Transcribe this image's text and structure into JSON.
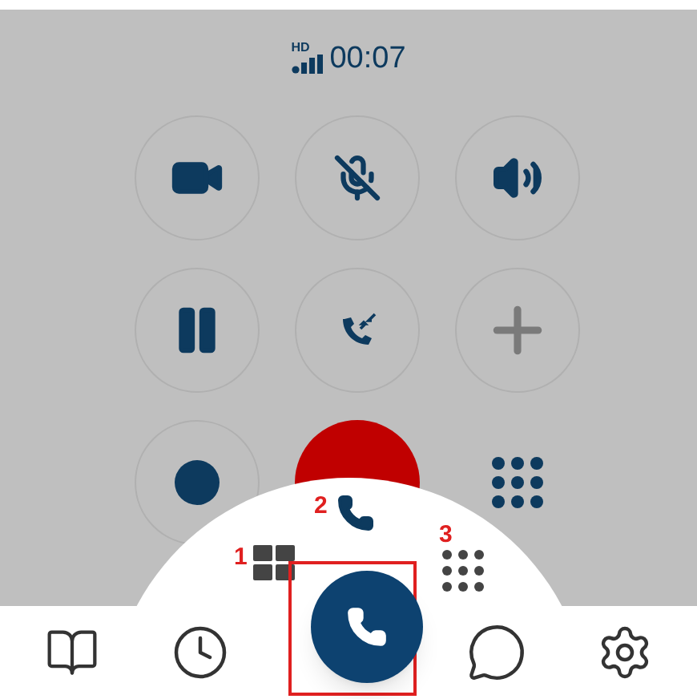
{
  "call_status": {
    "quality_badge": "HD",
    "elapsed_time": "00:07"
  },
  "controls": [
    {
      "kind": "video"
    },
    {
      "kind": "mute"
    },
    {
      "kind": "speaker"
    },
    {
      "kind": "hold"
    },
    {
      "kind": "merge"
    },
    {
      "kind": "add"
    },
    {
      "kind": "record"
    },
    {
      "kind": "hangup"
    },
    {
      "kind": "keypad"
    }
  ],
  "quick_menu": [
    {
      "kind": "grid",
      "marker": "1"
    },
    {
      "kind": "call",
      "marker": "2"
    },
    {
      "kind": "dialpad",
      "marker": "3"
    }
  ],
  "bottom_nav": [
    {
      "kind": "contacts",
      "selected": false
    },
    {
      "kind": "history",
      "selected": false
    },
    {
      "kind": "call",
      "selected": true
    },
    {
      "kind": "chat",
      "selected": false
    },
    {
      "kind": "settings",
      "selected": false
    }
  ]
}
